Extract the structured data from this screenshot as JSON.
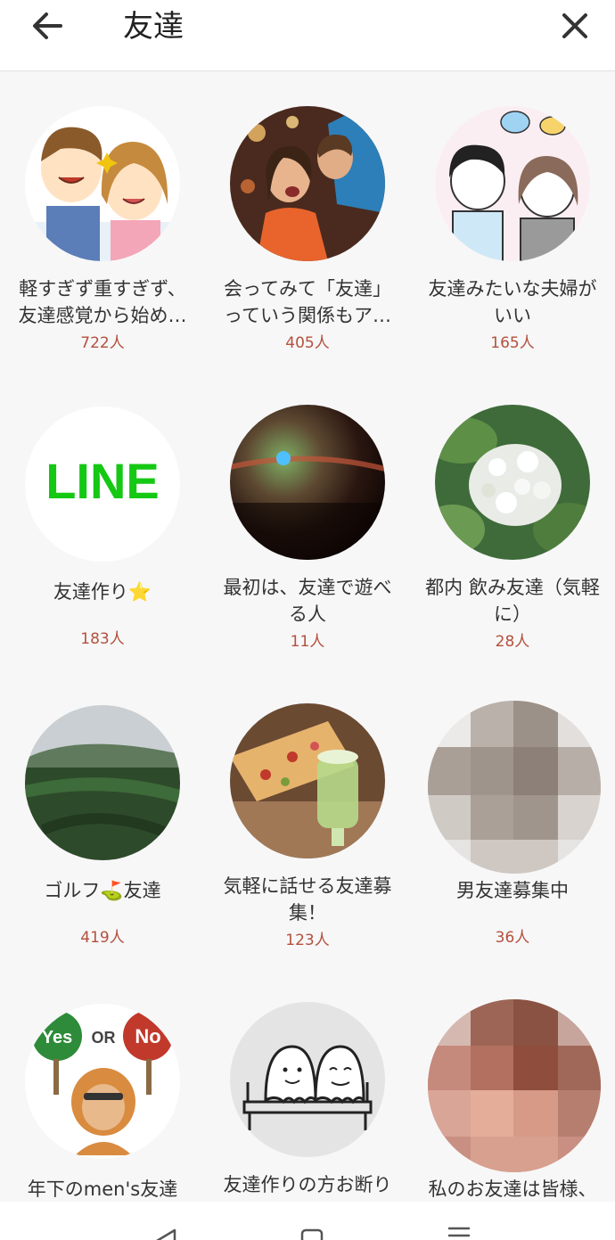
{
  "header": {
    "back_icon": "arrow-left-icon",
    "title": "友達",
    "close_icon": "close-icon"
  },
  "accent_color": "#b4503c",
  "groups": [
    {
      "name": "軽すぎず重すぎず、友達感覚から始め…",
      "members": "722人",
      "image": "cartoon-couple"
    },
    {
      "name": "会ってみて「友達」っていう関係もア…",
      "members": "405人",
      "image": "photo-friends-concert"
    },
    {
      "name": "友達みたいな夫婦がいい",
      "members": "165人",
      "image": "cartoon-couple-chat"
    },
    {
      "name": "友達作り⭐",
      "members": "183人",
      "image": "line-logo"
    },
    {
      "name": "最初は、友達で遊べる人",
      "members": "11人",
      "image": "photo-sunset"
    },
    {
      "name": "都内 飲み友達（気軽に）",
      "members": "28人",
      "image": "photo-white-flowers"
    },
    {
      "name": "ゴルフ⛳友達",
      "members": "419人",
      "image": "photo-golf-course"
    },
    {
      "name": "気軽に話せる友達募集！",
      "members": "123人",
      "image": "photo-pizza-drink"
    },
    {
      "name": "男友達募集中",
      "members": "36人",
      "image": "pixelated-photo"
    },
    {
      "name": "年下のmen's友達",
      "members": "",
      "image": "cartoon-yes-or-no"
    },
    {
      "name": "友達作りの方お断り",
      "members": "",
      "image": "cartoon-two-ghosts"
    },
    {
      "name": "私のお友達は皆様、",
      "members": "",
      "image": "pixelated-face"
    }
  ],
  "nav": {
    "back_icon": "nav-back-icon",
    "home_icon": "nav-home-icon",
    "menu_icon": "nav-menu-icon"
  }
}
